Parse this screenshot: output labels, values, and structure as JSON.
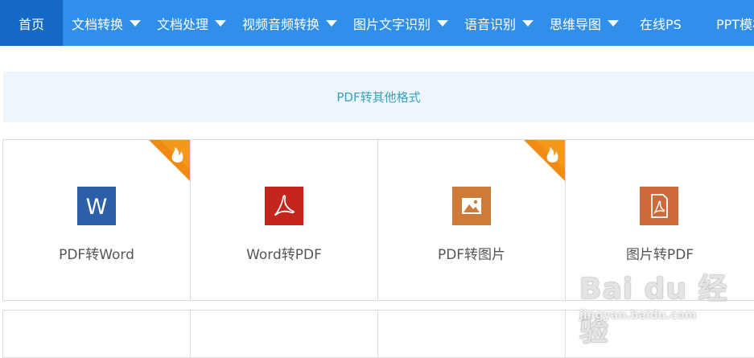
{
  "nav": {
    "items": [
      {
        "label": "首页"
      },
      {
        "label": "文档转换"
      },
      {
        "label": "文档处理"
      },
      {
        "label": "视频音频转换"
      },
      {
        "label": "图片文字识别"
      },
      {
        "label": "语音识别"
      },
      {
        "label": "思维导图"
      },
      {
        "label": "在线PS"
      },
      {
        "label": "PPT模板"
      }
    ],
    "active_index": 0
  },
  "section": {
    "title": "PDF转其他格式"
  },
  "tools": [
    {
      "label": "PDF转Word",
      "icon": "word-icon",
      "hot": true,
      "color": "#2b5fa8"
    },
    {
      "label": "Word转PDF",
      "icon": "pdf-icon",
      "hot": false,
      "color": "#c4261e"
    },
    {
      "label": "PDF转图片",
      "icon": "image-icon",
      "hot": true,
      "color": "#d07a3a"
    },
    {
      "label": "图片转PDF",
      "icon": "pdf-doc-icon",
      "hot": false,
      "color": "#cc6a3c"
    }
  ],
  "hot_badge_icon": "flame-icon",
  "watermark": {
    "main": "Bai du 经验",
    "sub": "jingyan.baidu.com"
  },
  "colors": {
    "nav_bg": "#2f8fea",
    "nav_active_bg": "#1469c4",
    "banner_bg": "#eef6fd",
    "banner_text": "#3d9fb9",
    "hot_badge": "#f08a12"
  }
}
